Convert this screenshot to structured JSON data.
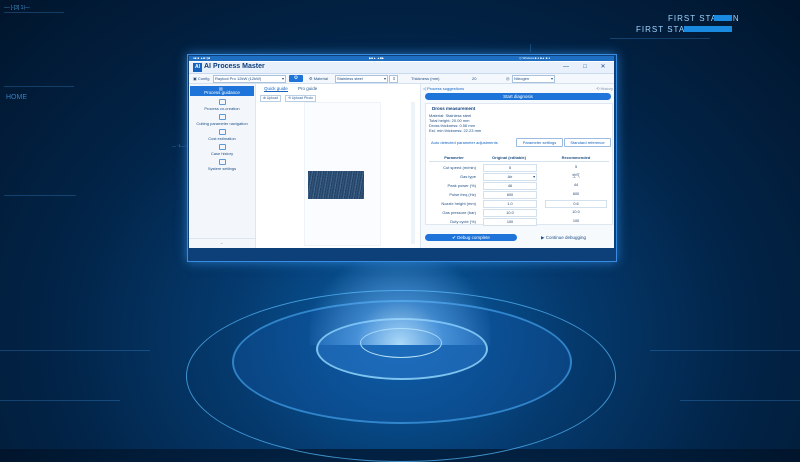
{
  "hud": {
    "left_code": "—·[-[3] 1|—",
    "left_heading": "HOME",
    "station_primary": "FIRST STATION",
    "station_secondary": "FIRST STATION",
    "mid_label": "— ·1—·— —"
  },
  "colors": {
    "accent": "#1e74d8",
    "background": "#022448",
    "panel": "#ffffff"
  },
  "os_bar": {
    "left": "●■ ■ ▲■□[]■",
    "center": "▶■▲ ▲■▶",
    "right": "◷ Wireless ■ ● ■▲ ■ ●"
  },
  "app": {
    "logo": "AI",
    "title": "AI Process Master",
    "min_icon": "—",
    "max_icon": "□",
    "close_icon": "✕"
  },
  "toolbar": {
    "config_label": "Config",
    "config_value": "Raytool Pro 12kW (12kW)",
    "material_label": "Material",
    "material_value": "Stainless steel",
    "thickness_label": "Thickness (mm)",
    "thickness_value": "20",
    "gas_value": "Nitrogen"
  },
  "sidebar": {
    "head": "Process guidance",
    "items": [
      {
        "label": "Process co-creation"
      },
      {
        "label": "Cutting parameter navigation"
      },
      {
        "label": "Cost estimation"
      },
      {
        "label": "Case history"
      },
      {
        "label": "System settings"
      }
    ]
  },
  "center": {
    "tabs": [
      "Quick guide",
      "Pro guide"
    ],
    "btn_upload": "⊕ Upload",
    "btn_detect": "⟲ Upload Photo"
  },
  "right": {
    "heading": "Process suggestions",
    "history": "History",
    "diagnose": "Start diagnosis",
    "card_title": "Dross measurement",
    "info": [
      "Material: Stainless steel",
      "Total height: 20.00 mm",
      "Dross thickness: 0.56 mm",
      "Est. min thickness: 22.23 mm"
    ],
    "adjust_label": "Auto detected parameter adjustments",
    "btn_param": "Parameter settings",
    "btn_std": "Standard reference",
    "col_param": "Parameter",
    "col_orig": "Original (editable)",
    "col_rec": "Recommended",
    "rows": [
      {
        "label": "Cut speed (m/min)",
        "orig": "5",
        "rec": "5"
      },
      {
        "label": "Gas type",
        "orig": "Air",
        "rec": "空气"
      },
      {
        "label": "Peak power (%)",
        "orig": "46",
        "rec": "44"
      },
      {
        "label": "Pulse freq (Hz)",
        "orig": "600",
        "rec": "600"
      },
      {
        "label": "Nozzle height (mm)",
        "orig": "1.0",
        "rec": "0.6"
      },
      {
        "label": "Gas pressure (bar)",
        "orig": "10.0",
        "rec": "10.0"
      },
      {
        "label": "Duty cycle (%)",
        "orig": "100",
        "rec": "100"
      }
    ],
    "debug": "✔ Debug complete",
    "continue": "▶ Continue debugging"
  }
}
